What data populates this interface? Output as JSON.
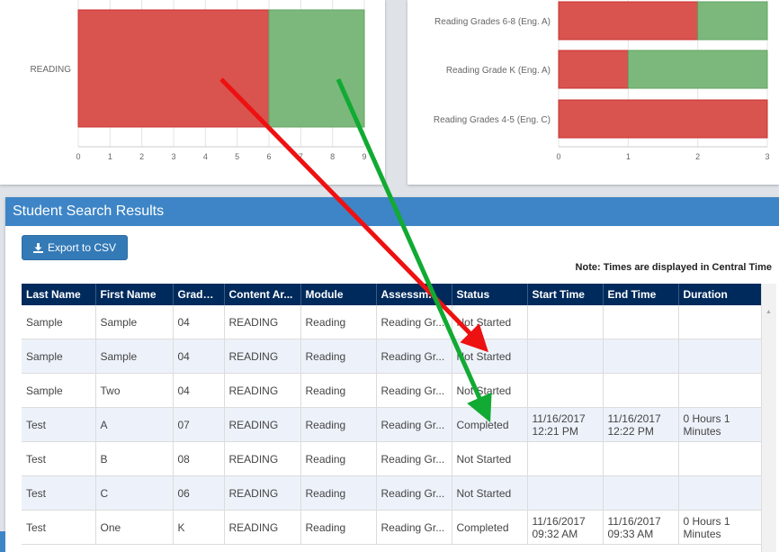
{
  "chart_data": [
    {
      "type": "bar",
      "orientation": "horizontal",
      "stacked": true,
      "categories": [
        "READING"
      ],
      "series": [
        {
          "color": "#d9534f",
          "values": [
            6
          ]
        },
        {
          "color": "#7cb87c",
          "values": [
            3
          ]
        }
      ],
      "xlim": [
        0,
        9
      ],
      "xticks": [
        "0",
        "1",
        "2",
        "3",
        "4",
        "5",
        "6",
        "7",
        "8",
        "9"
      ]
    },
    {
      "type": "bar",
      "orientation": "horizontal",
      "stacked": true,
      "categories": [
        "Reading Grades 6-8 (Eng. A)",
        "Reading Grade K (Eng. A)",
        "Reading Grades 4-5 (Eng. C)"
      ],
      "series": [
        {
          "color": "#d9534f",
          "values": [
            2,
            1,
            3
          ]
        },
        {
          "color": "#7cb87c",
          "values": [
            1,
            2,
            0
          ]
        }
      ],
      "xlim": [
        0,
        3
      ],
      "xticks": [
        "0",
        "1",
        "2",
        "3"
      ]
    }
  ],
  "results": {
    "title": "Student Search Results",
    "export_label": "Export to CSV",
    "export_icon": "download-icon",
    "note": "Note: Times are displayed in Central Time",
    "columns": [
      "Last Name",
      "First Name",
      "Grade ...",
      "Content Ar...",
      "Module",
      "Assessm...",
      "Status",
      "Start Time",
      "End Time",
      "Duration"
    ],
    "rows": [
      [
        "Sample",
        "Sample",
        "04",
        "READING",
        "Reading",
        "Reading Gr...",
        "Not Started",
        "",
        "",
        ""
      ],
      [
        "Sample",
        "Sample",
        "04",
        "READING",
        "Reading",
        "Reading Gr...",
        "Not Started",
        "",
        "",
        ""
      ],
      [
        "Sample",
        "Two",
        "04",
        "READING",
        "Reading",
        "Reading Gr...",
        "Not Started",
        "",
        "",
        ""
      ],
      [
        "Test",
        "A",
        "07",
        "READING",
        "Reading",
        "Reading Gr...",
        "Completed",
        "11/16/2017 12:21 PM",
        "11/16/2017 12:22 PM",
        "0 Hours 1 Minutes"
      ],
      [
        "Test",
        "B",
        "08",
        "READING",
        "Reading",
        "Reading Gr...",
        "Not Started",
        "",
        "",
        ""
      ],
      [
        "Test",
        "C",
        "06",
        "READING",
        "Reading",
        "Reading Gr...",
        "Not Started",
        "",
        "",
        ""
      ],
      [
        "Test",
        "One",
        "K",
        "READING",
        "Reading",
        "Reading Gr...",
        "Completed",
        "11/16/2017 09:32 AM",
        "11/16/2017 09:33 AM",
        "0 Hours 1 Minutes"
      ]
    ]
  },
  "annotations": {
    "red_arrow_color": "#ee1111",
    "green_arrow_color": "#11aa33"
  }
}
